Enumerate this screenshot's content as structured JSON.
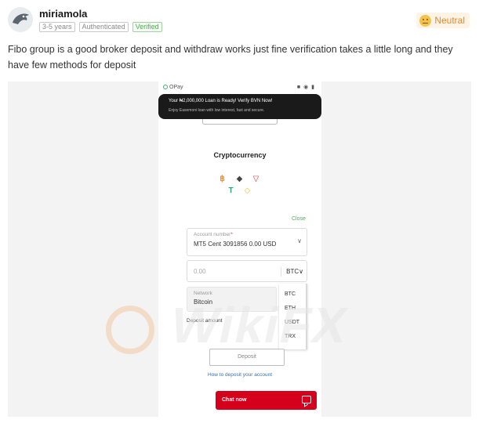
{
  "review": {
    "username": "miriamola",
    "tags": [
      "3-5 years",
      "Authenticated",
      "Verified"
    ],
    "sentiment": "Neutral",
    "text": "Fibo group is a good broker deposit and withdraw works just fine verification takes a little long and they have few methods for deposit"
  },
  "phone": {
    "status_app": "OPay",
    "status_icons": "■ ◉ ▮",
    "toast_title": "Your ₦2,000,000 Loan is Ready! Verify BVN Now!",
    "toast_sub": "Enjoy Easemoni loan with low interest, fast and secure.",
    "section_title": "Cryptocurrency",
    "coins": [
      "BTC",
      "ETH",
      "TRX",
      "USDT",
      "BNB"
    ],
    "coin_glyphs": {
      "btc": "฿",
      "eth": "◆",
      "trx": "▽",
      "usdt": "T",
      "bnb": "◇"
    },
    "close_label": "Close",
    "account_label": "Account number",
    "account_required": "*",
    "account_value": "MT5 Cent 3091856 0.00 USD",
    "amount_placeholder": "0.00",
    "currency_selected": "BTC",
    "chevron": "∨",
    "network_label": "Network",
    "network_value": "Bitcoin",
    "currency_options": [
      "BTC",
      "ETH",
      "USDT",
      "TRX"
    ],
    "deposit_amount_label": "Deposit amount",
    "deposit_button": "Deposit",
    "howto_link": "How to deposit your account",
    "chat_label": "Chat now"
  },
  "watermark": {
    "text": "WikiFX"
  },
  "colors": {
    "sentiment": "#e08a2e",
    "verified": "#4caf50",
    "chat": "#d5001c",
    "link": "#3a6fb0"
  }
}
